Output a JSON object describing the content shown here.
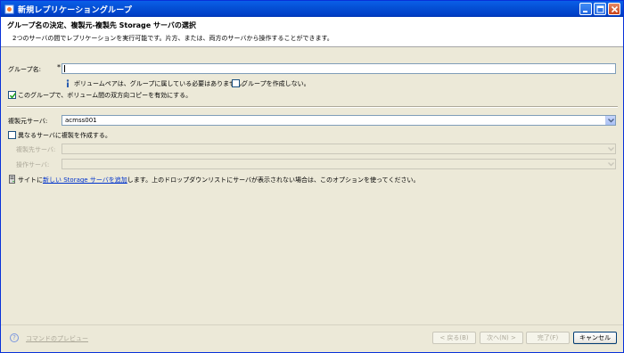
{
  "window": {
    "title": "新規レプリケーショングループ"
  },
  "banner": {
    "title": "グループ名の決定、複製元-複製先 Storage サーバの選択",
    "description": "2つのサーバの間でレプリケーションを実行可能です。片方、または、両方のサーバから操作することができます。"
  },
  "group": {
    "label": "グループ名:",
    "required_marker": "*",
    "value": "",
    "info_text": "ボリュームペアは、グループに属している必要はありません。",
    "no_group_label": "グループを作成しない。",
    "no_group_checked": false
  },
  "bidirectional": {
    "label": "このグループで、ボリューム間の双方向コピーを有効にする。",
    "checked": true
  },
  "source": {
    "label": "複製元サーバ:",
    "value": "acmss001"
  },
  "different_servers": {
    "label": "異なるサーバに複製を作成する。",
    "checked": false
  },
  "target": {
    "label": "複製先サーバ:",
    "value": ""
  },
  "operation": {
    "label": "操作サーバ:",
    "value": ""
  },
  "add_storage": {
    "prefix": "サイトに",
    "link": "新しい Storage サーバを追加",
    "suffix": "します。上のドロップダウンリストにサーバが表示されない場合は、このオプションを使ってください。"
  },
  "footer": {
    "preview_label": "コマンドのプレビュー",
    "back_label": "< 戻る(B)",
    "next_label": "次へ(N) >",
    "finish_label": "完了(F)",
    "cancel_label": "キャンセル"
  },
  "icons": {
    "app": "app-icon",
    "info": "info-icon",
    "help": "help-icon",
    "add": "server-add-icon"
  }
}
